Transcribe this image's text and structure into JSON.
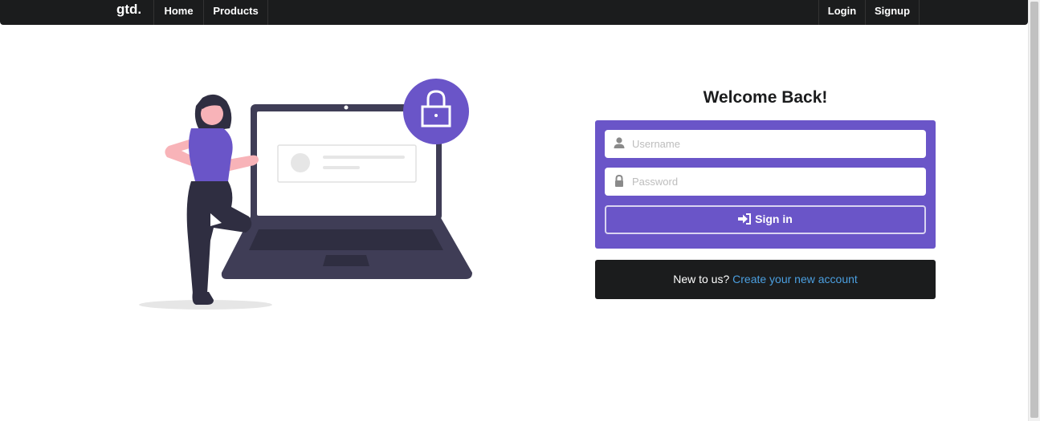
{
  "navbar": {
    "brand": "gtd.",
    "left_items": [
      {
        "label": "Home"
      },
      {
        "label": "Products"
      }
    ],
    "right_items": [
      {
        "label": "Login"
      },
      {
        "label": "Signup"
      }
    ]
  },
  "login": {
    "heading": "Welcome Back!",
    "username": {
      "placeholder": "Username",
      "value": "",
      "icon": "user-icon"
    },
    "password": {
      "placeholder": "Password",
      "value": "",
      "icon": "lock-icon"
    },
    "submit": {
      "label": "Sign in",
      "icon": "sign-in-icon"
    }
  },
  "register": {
    "prompt": "New to us?",
    "link": "Create your new account"
  },
  "colors": {
    "navbar_bg": "#1b1c1d",
    "accent": "#6a55c8",
    "link": "#4b9fe0"
  }
}
